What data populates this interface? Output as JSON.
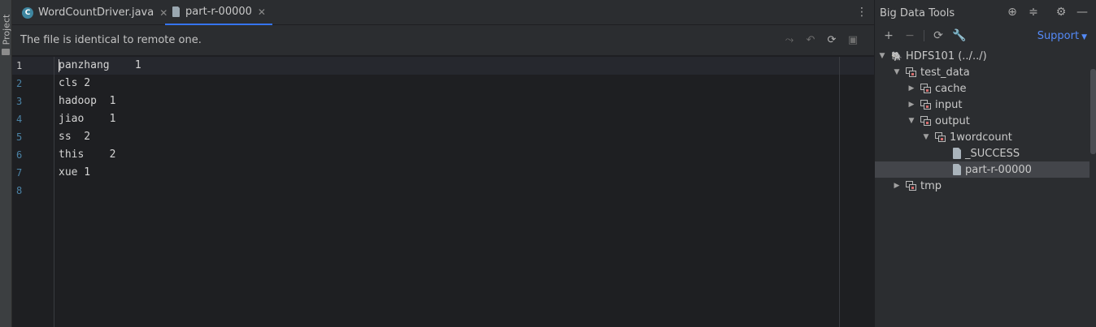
{
  "left_strip": {
    "project_label": "Project"
  },
  "tabs": [
    {
      "label": "WordCountDriver.java",
      "icon": "class-c-icon",
      "active": false
    },
    {
      "label": "part-r-00000",
      "icon": "remote-file-icon",
      "active": true
    }
  ],
  "infobar": {
    "message": "The file is identical to remote one."
  },
  "editor": {
    "line_numbers": [
      "1",
      "2",
      "3",
      "4",
      "5",
      "6",
      "7",
      "8"
    ],
    "lines": [
      "panzhang    1",
      "cls 2",
      "hadoop  1",
      "jiao    1",
      "ss  2",
      "this    2",
      "xue 1",
      ""
    ]
  },
  "panel": {
    "title": "Big Data Tools",
    "support_label": "Support",
    "tree": [
      {
        "label": "HDFS101 (../../)",
        "kind": "hdfs",
        "expanded": true
      },
      {
        "label": "test_data",
        "kind": "folder",
        "expanded": true
      },
      {
        "label": "cache",
        "kind": "folder",
        "expanded": false
      },
      {
        "label": "input",
        "kind": "folder",
        "expanded": false
      },
      {
        "label": "output",
        "kind": "folder",
        "expanded": true
      },
      {
        "label": "1wordcount",
        "kind": "folder",
        "expanded": true
      },
      {
        "label": "_SUCCESS",
        "kind": "file"
      },
      {
        "label": "part-r-00000",
        "kind": "file",
        "selected": true
      },
      {
        "label": "tmp",
        "kind": "folder",
        "expanded": false
      }
    ]
  },
  "colors": {
    "accent": "#3574f0",
    "link": "#548af7",
    "line_number": "#4b83a6"
  }
}
